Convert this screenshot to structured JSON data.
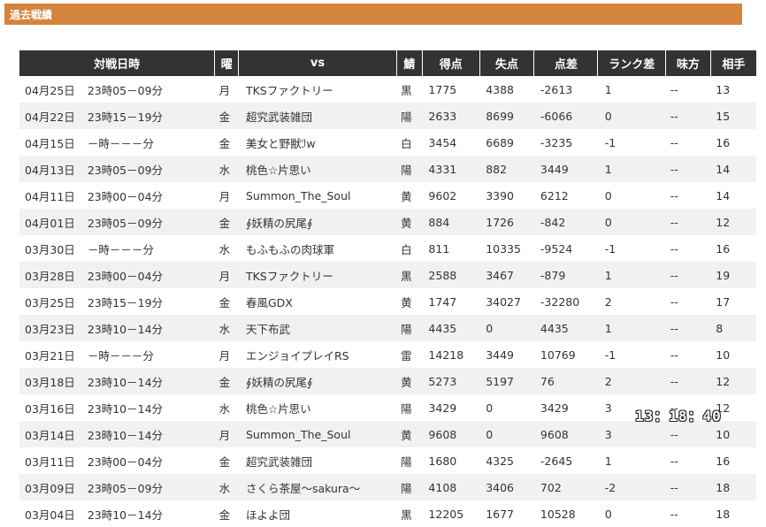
{
  "section": {
    "title": "過去戦績"
  },
  "table": {
    "headers": [
      "対戦日時",
      "曜",
      "vs",
      "鯖",
      "得点",
      "失点",
      "点差",
      "ランク差",
      "味方",
      "相手"
    ],
    "rows": [
      {
        "date": "04月25日",
        "time": "23時05－09分",
        "day": "月",
        "vs": "TKSファクトリー",
        "server": "黒",
        "score": "1775",
        "lost": "4388",
        "diff": "-2613",
        "rank": "1",
        "ally": "--",
        "opp": "13"
      },
      {
        "date": "04月22日",
        "time": "23時15－19分",
        "day": "金",
        "vs": "超究武装雑団",
        "server": "陽",
        "score": "2633",
        "lost": "8699",
        "diff": "-6066",
        "rank": "0",
        "ally": "--",
        "opp": "15"
      },
      {
        "date": "04月15日",
        "time": "－時－－－分",
        "day": "金",
        "vs": "美女と野獣ℐw",
        "server": "白",
        "score": "3454",
        "lost": "6689",
        "diff": "-3235",
        "rank": "-1",
        "ally": "--",
        "opp": "16"
      },
      {
        "date": "04月13日",
        "time": "23時05－09分",
        "day": "水",
        "vs": "桃色☆片思い",
        "server": "陽",
        "score": "4331",
        "lost": "882",
        "diff": "3449",
        "rank": "1",
        "ally": "--",
        "opp": "14"
      },
      {
        "date": "04月11日",
        "time": "23時00－04分",
        "day": "月",
        "vs": "Summon_The_Soul",
        "server": "黄",
        "score": "9602",
        "lost": "3390",
        "diff": "6212",
        "rank": "0",
        "ally": "--",
        "opp": "14"
      },
      {
        "date": "04月01日",
        "time": "23時05－09分",
        "day": "金",
        "vs": "∮妖精の尻尾∮",
        "server": "黄",
        "score": "884",
        "lost": "1726",
        "diff": "-842",
        "rank": "0",
        "ally": "--",
        "opp": "12"
      },
      {
        "date": "03月30日",
        "time": "－時－－－分",
        "day": "水",
        "vs": "もふもふの肉球軍",
        "server": "白",
        "score": "811",
        "lost": "10335",
        "diff": "-9524",
        "rank": "-1",
        "ally": "--",
        "opp": "16"
      },
      {
        "date": "03月28日",
        "time": "23時00－04分",
        "day": "月",
        "vs": "TKSファクトリー",
        "server": "黒",
        "score": "2588",
        "lost": "3467",
        "diff": "-879",
        "rank": "1",
        "ally": "--",
        "opp": "19"
      },
      {
        "date": "03月25日",
        "time": "23時15－19分",
        "day": "金",
        "vs": "春風GDX",
        "server": "黄",
        "score": "1747",
        "lost": "34027",
        "diff": "-32280",
        "rank": "2",
        "ally": "--",
        "opp": "17"
      },
      {
        "date": "03月23日",
        "time": "23時10－14分",
        "day": "水",
        "vs": "天下布武",
        "server": "陽",
        "score": "4435",
        "lost": "0",
        "diff": "4435",
        "rank": "1",
        "ally": "--",
        "opp": "8"
      },
      {
        "date": "03月21日",
        "time": "－時－－－分",
        "day": "月",
        "vs": "エンジョイプレイRS",
        "server": "雷",
        "score": "14218",
        "lost": "3449",
        "diff": "10769",
        "rank": "-1",
        "ally": "--",
        "opp": "10"
      },
      {
        "date": "03月18日",
        "time": "23時10－14分",
        "day": "金",
        "vs": "∮妖精の尻尾∮",
        "server": "黄",
        "score": "5273",
        "lost": "5197",
        "diff": "76",
        "rank": "2",
        "ally": "--",
        "opp": "12"
      },
      {
        "date": "03月16日",
        "time": "23時10－14分",
        "day": "水",
        "vs": "桃色☆片思い",
        "server": "陽",
        "score": "3429",
        "lost": "0",
        "diff": "3429",
        "rank": "3",
        "ally": "--",
        "opp": "12"
      },
      {
        "date": "03月14日",
        "time": "23時10－14分",
        "day": "月",
        "vs": "Summon_The_Soul",
        "server": "黄",
        "score": "9608",
        "lost": "0",
        "diff": "9608",
        "rank": "3",
        "ally": "--",
        "opp": "10"
      },
      {
        "date": "03月11日",
        "time": "23時00－04分",
        "day": "金",
        "vs": "超究武装雑団",
        "server": "陽",
        "score": "1680",
        "lost": "4325",
        "diff": "-2645",
        "rank": "1",
        "ally": "--",
        "opp": "16"
      },
      {
        "date": "03月09日",
        "time": "23時05－09分",
        "day": "水",
        "vs": "さくら茶屋～sakura～",
        "server": "陽",
        "score": "4108",
        "lost": "3406",
        "diff": "702",
        "rank": "-2",
        "ally": "--",
        "opp": "18"
      },
      {
        "date": "03月04日",
        "time": "23時10－14分",
        "day": "金",
        "vs": "ほよよ団",
        "server": "黒",
        "score": "12205",
        "lost": "1677",
        "diff": "10528",
        "rank": "0",
        "ally": "--",
        "opp": "18"
      }
    ]
  },
  "clock": {
    "time": "13：18：40"
  }
}
